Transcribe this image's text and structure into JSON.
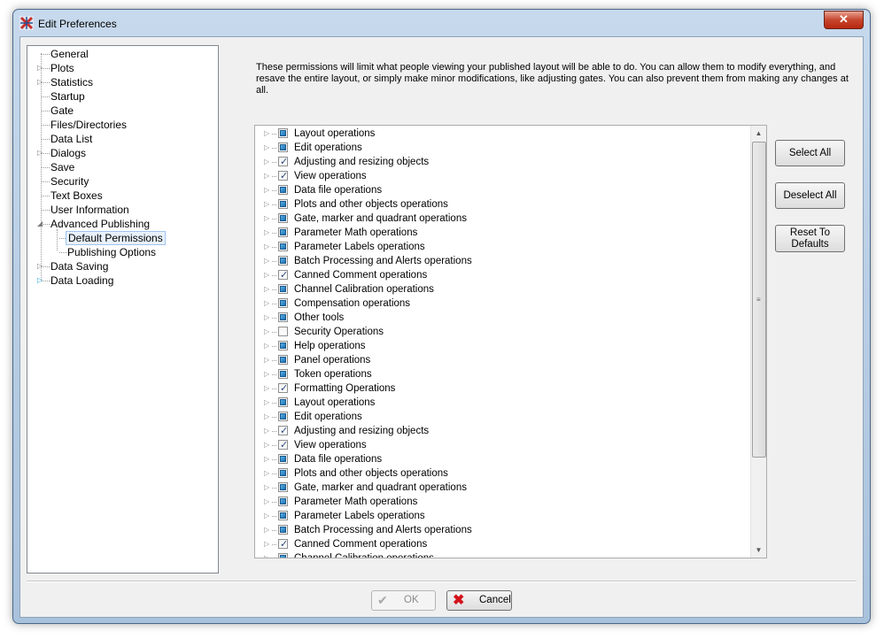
{
  "window": {
    "title": "Edit Preferences",
    "close_label": "✕"
  },
  "tree": {
    "items": [
      {
        "label": "General",
        "expander": "",
        "level": 0
      },
      {
        "label": "Plots",
        "expander": "▷",
        "level": 0
      },
      {
        "label": "Statistics",
        "expander": "▷",
        "level": 0
      },
      {
        "label": "Startup",
        "expander": "",
        "level": 0
      },
      {
        "label": "Gate",
        "expander": "",
        "level": 0
      },
      {
        "label": "Files/Directories",
        "expander": "",
        "level": 0
      },
      {
        "label": "Data List",
        "expander": "",
        "level": 0
      },
      {
        "label": "Dialogs",
        "expander": "▷",
        "level": 0
      },
      {
        "label": "Save",
        "expander": "",
        "level": 0
      },
      {
        "label": "Security",
        "expander": "",
        "level": 0
      },
      {
        "label": "Text Boxes",
        "expander": "",
        "level": 0
      },
      {
        "label": "User Information",
        "expander": "",
        "level": 0
      },
      {
        "label": "Advanced Publishing",
        "expander": "◢",
        "level": 0
      },
      {
        "label": "Default Permissions",
        "expander": "",
        "level": 1,
        "selected": true
      },
      {
        "label": "Publishing Options",
        "expander": "",
        "level": 1
      },
      {
        "label": "Data Saving",
        "expander": "▷",
        "level": 0
      },
      {
        "label": "Data Loading",
        "expander": "▷",
        "level": 0,
        "hover": true
      }
    ]
  },
  "description": "These permissions will limit what people viewing your published layout will be able to do.  You can allow them to modify everything, and resave the entire layout, or simply make minor modifications, like adjusting gates. You can also prevent them from making any changes at all.",
  "permissions": [
    {
      "label": "Layout operations",
      "state": "partial"
    },
    {
      "label": "Edit operations",
      "state": "partial"
    },
    {
      "label": "Adjusting and resizing objects",
      "state": "checked"
    },
    {
      "label": "View operations",
      "state": "checked"
    },
    {
      "label": "Data file operations",
      "state": "partial"
    },
    {
      "label": "Plots and other objects operations",
      "state": "partial"
    },
    {
      "label": "Gate, marker and quadrant operations",
      "state": "partial"
    },
    {
      "label": "Parameter Math operations",
      "state": "partial"
    },
    {
      "label": "Parameter Labels operations",
      "state": "partial"
    },
    {
      "label": "Batch Processing and Alerts operations",
      "state": "partial"
    },
    {
      "label": "Canned Comment operations",
      "state": "checked"
    },
    {
      "label": "Channel Calibration operations",
      "state": "partial"
    },
    {
      "label": "Compensation operations",
      "state": "partial"
    },
    {
      "label": "Other tools",
      "state": "partial"
    },
    {
      "label": "Security Operations",
      "state": "unchecked"
    },
    {
      "label": "Help operations",
      "state": "partial"
    },
    {
      "label": "Panel operations",
      "state": "partial"
    },
    {
      "label": "Token operations",
      "state": "partial"
    },
    {
      "label": "Formatting Operations",
      "state": "checked"
    },
    {
      "label": "Layout operations",
      "state": "partial"
    },
    {
      "label": "Edit operations",
      "state": "partial"
    },
    {
      "label": "Adjusting and resizing objects",
      "state": "checked"
    },
    {
      "label": "View operations",
      "state": "checked"
    },
    {
      "label": "Data file operations",
      "state": "partial"
    },
    {
      "label": "Plots and other objects operations",
      "state": "partial"
    },
    {
      "label": "Gate, marker and quadrant operations",
      "state": "partial"
    },
    {
      "label": "Parameter Math operations",
      "state": "partial"
    },
    {
      "label": "Parameter Labels operations",
      "state": "partial"
    },
    {
      "label": "Batch Processing and Alerts operations",
      "state": "partial"
    },
    {
      "label": "Canned Comment operations",
      "state": "checked"
    },
    {
      "label": "Channel Calibration operations",
      "state": "partial"
    }
  ],
  "buttons": {
    "select_all": "Select All",
    "deselect_all": "Deselect All",
    "reset_line1": "Reset To",
    "reset_line2": "Defaults",
    "ok": "OK",
    "cancel": "Cancel"
  }
}
